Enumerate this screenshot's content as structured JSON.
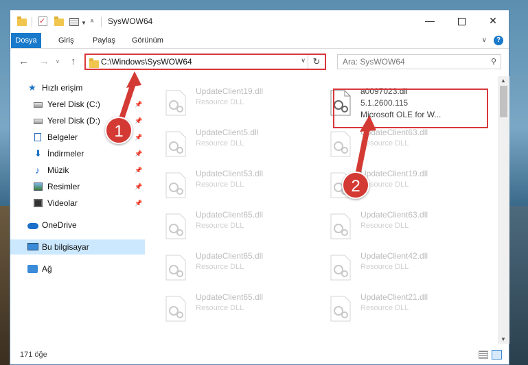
{
  "window": {
    "title": "SysWOW64"
  },
  "ribbon": {
    "tabs": [
      "Dosya",
      "Giriş",
      "Paylaş",
      "Görünüm"
    ]
  },
  "address": {
    "path": "C:\\Windows\\SysWOW64"
  },
  "search": {
    "placeholder": "Ara: SysWOW64"
  },
  "sidebar": {
    "quick_access": "Hızlı erişim",
    "items": [
      {
        "label": "Yerel Disk (C:)",
        "icon": "drive-icon",
        "pinned": true
      },
      {
        "label": "Yerel Disk (D:)",
        "icon": "drive-icon",
        "pinned": true
      },
      {
        "label": "Belgeler",
        "icon": "documents-icon",
        "pinned": true
      },
      {
        "label": "İndirmeler",
        "icon": "downloads-icon",
        "pinned": true
      },
      {
        "label": "Müzik",
        "icon": "music-icon",
        "pinned": true
      },
      {
        "label": "Resimler",
        "icon": "pictures-icon",
        "pinned": true
      },
      {
        "label": "Videolar",
        "icon": "videos-icon",
        "pinned": true
      }
    ],
    "onedrive": "OneDrive",
    "this_pc": "Bu bilgisayar",
    "network": "Ağ"
  },
  "files": {
    "highlighted": {
      "name": "a0097023.dll",
      "version": "5.1.2600.115",
      "description": "Microsoft OLE for W..."
    },
    "left_column": [
      {
        "name": "UpdateClient19.dll",
        "type": "Resource DLL"
      },
      {
        "name": "UpdateClient5.dll",
        "type": "Resource DLL"
      },
      {
        "name": "UpdateClient53.dll",
        "type": "Resource DLL"
      },
      {
        "name": "UpdateClient65.dll",
        "type": "Resource DLL"
      },
      {
        "name": "UpdateClient65.dll",
        "type": "Resource DLL"
      },
      {
        "name": "UpdateClient65.dll",
        "type": "Resource DLL"
      }
    ],
    "right_column": [
      {
        "name": "UpdateClient63.dll",
        "type": "Resource DLL"
      },
      {
        "name": "UpdateClient19.dll",
        "type": "Resource DLL"
      },
      {
        "name": "UpdateClient63.dll",
        "type": "Resource DLL"
      },
      {
        "name": "UpdateClient42.dll",
        "type": "Resource DLL"
      },
      {
        "name": "UpdateClient21.dll",
        "type": "Resource DLL"
      }
    ]
  },
  "status": {
    "count": "171 öğe"
  },
  "annotations": {
    "step1": "1",
    "step2": "2"
  }
}
